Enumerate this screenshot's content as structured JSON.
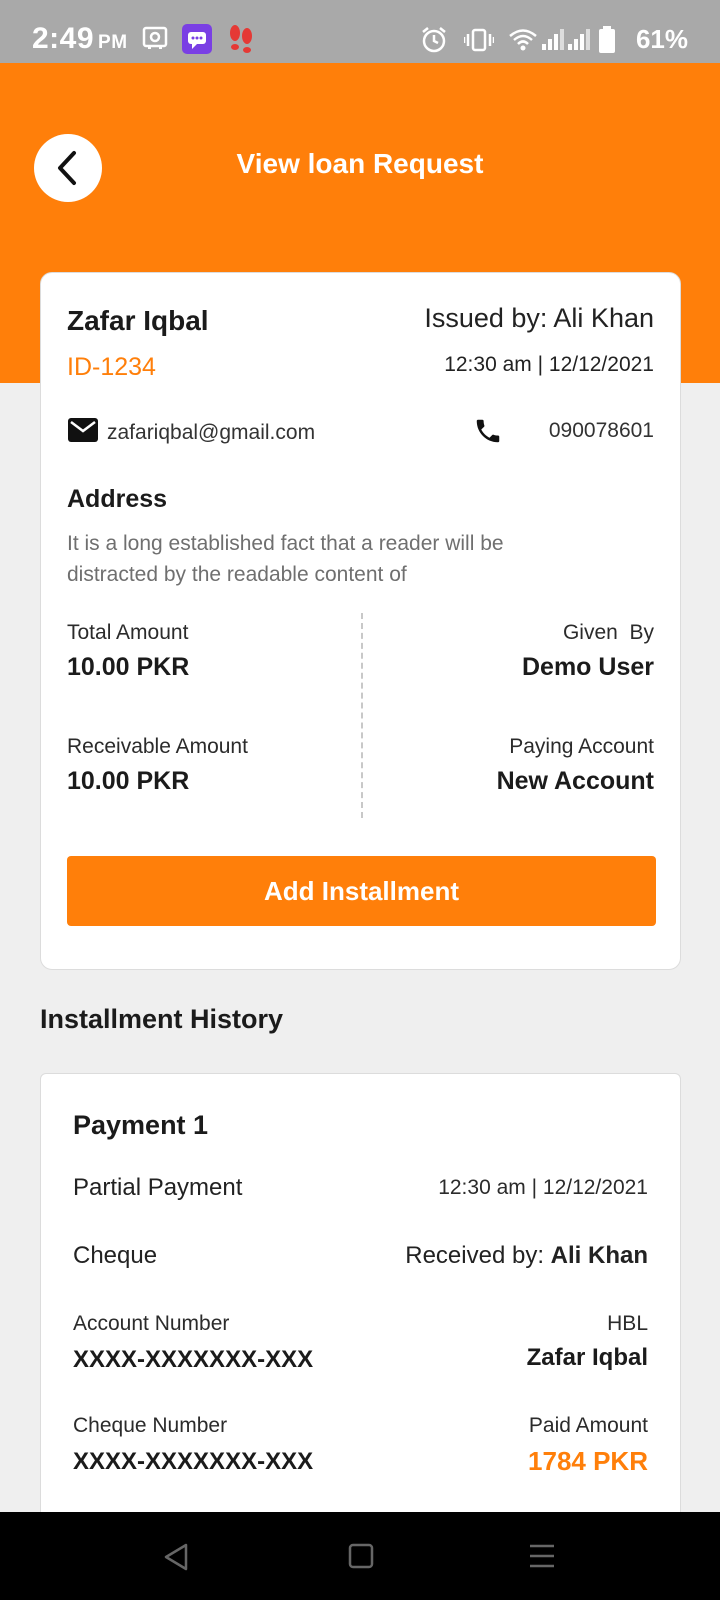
{
  "status_bar": {
    "time": "2:49",
    "ampm": "PM",
    "battery": "61%"
  },
  "header": {
    "title": "View loan Request"
  },
  "customer": {
    "name": "Zafar Iqbal",
    "issued_by": "Issued by: Ali Khan",
    "id": "ID-1234",
    "datetime": "12:30 am | 12/12/2021",
    "email": "zafariqbal@gmail.com",
    "phone": "090078601",
    "address_label": "Address",
    "address": "It is a long established fact that a reader will be distracted by the readable content of"
  },
  "amounts": {
    "total_label": "Total Amount",
    "total_value": "10.00 PKR",
    "given_label": "Given  By",
    "given_value": "Demo User",
    "receivable_label": "Receivable Amount",
    "receivable_value": "10.00 PKR",
    "paying_label": "Paying Account",
    "paying_value": "New Account"
  },
  "add_button": "Add Installment",
  "history": {
    "title": "Installment History",
    "payment": {
      "title": "Payment 1",
      "type": "Partial Payment",
      "datetime": "12:30 am | 12/12/2021",
      "method": "Cheque",
      "received_prefix": "Received by: ",
      "received_name": "Ali Khan",
      "account_label": "Account Number",
      "account_value": "XXXX-XXXXXXX-XXX",
      "bank": "HBL",
      "holder": "Zafar Iqbal",
      "cheque_label": "Cheque Number",
      "cheque_value": "XXXX-XXXXXXX-XXX",
      "paid_label": "Paid Amount",
      "paid_value": "1784 PKR"
    }
  },
  "colors": {
    "accent": "#ff7f0a",
    "status_bar": "#a9a9a9",
    "background": "#efefef"
  }
}
